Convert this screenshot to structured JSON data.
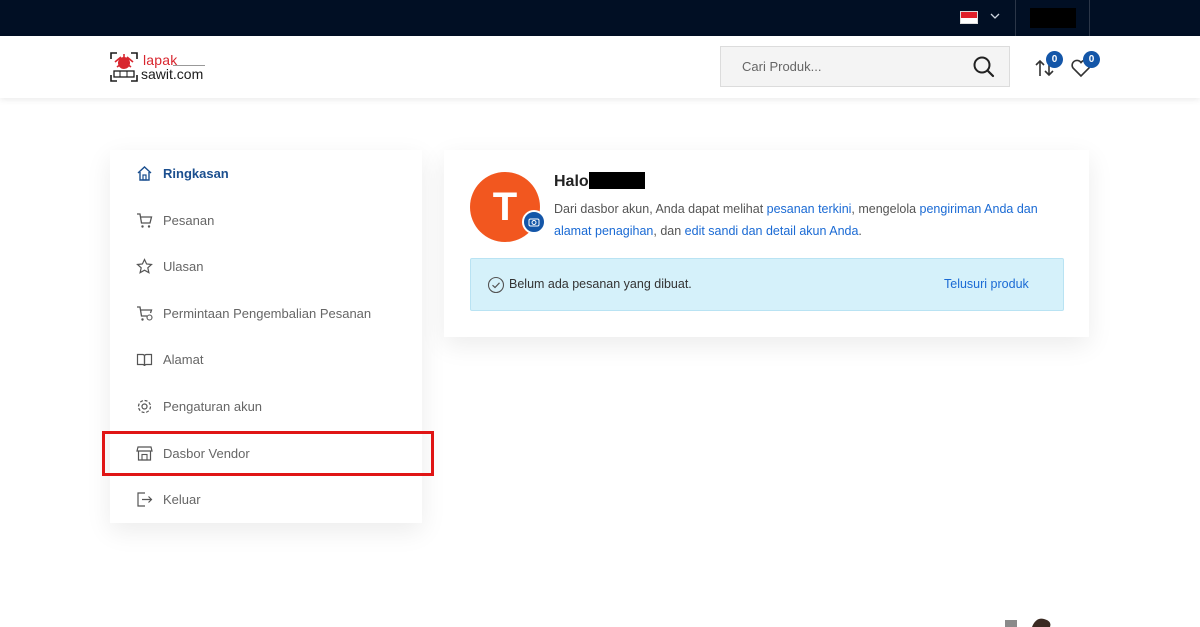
{
  "topbar": {
    "language_flag": "indonesia-flag",
    "user_name_redacted": ""
  },
  "header": {
    "logo": {
      "line1": "lapak",
      "line2": "sawit.com",
      "brand_color": "#d8262e"
    },
    "search": {
      "placeholder": "Cari Produk..."
    },
    "compare_count": "0",
    "wishlist_count": "0"
  },
  "sidebar": {
    "items": [
      {
        "label": "Ringkasan",
        "icon": "home-icon",
        "active": true
      },
      {
        "label": "Pesanan",
        "icon": "cart-icon"
      },
      {
        "label": "Ulasan",
        "icon": "star-icon"
      },
      {
        "label": "Permintaan Pengembalian Pesanan",
        "icon": "cart-return-icon"
      },
      {
        "label": "Alamat",
        "icon": "book-icon"
      },
      {
        "label": "Pengaturan akun",
        "icon": "gear-icon"
      },
      {
        "label": "Dasbor Vendor",
        "icon": "store-icon"
      },
      {
        "label": "Keluar",
        "icon": "logout-icon"
      }
    ]
  },
  "dashboard": {
    "avatar_letter": "T",
    "greeting": "Halo",
    "desc": {
      "t1": "Dari dasbor akun, Anda dapat melihat ",
      "l1": "pesanan terkini",
      "t2": ", mengelola ",
      "l2": "pengiriman Anda dan alamat penagihan",
      "t3": ", dan ",
      "l3": "edit sandi dan detail akun Anda",
      "t4": "."
    },
    "notice": {
      "text": "Belum ada pesanan yang dibuat.",
      "link": "Telusuri produk"
    }
  },
  "colors": {
    "topbar_bg": "#010f24",
    "accent_blue": "#1456a8",
    "link_blue": "#1a6ad4",
    "avatar_orange": "#f2571f",
    "notice_bg": "#d5f1fa",
    "highlight_red": "#e01515"
  }
}
